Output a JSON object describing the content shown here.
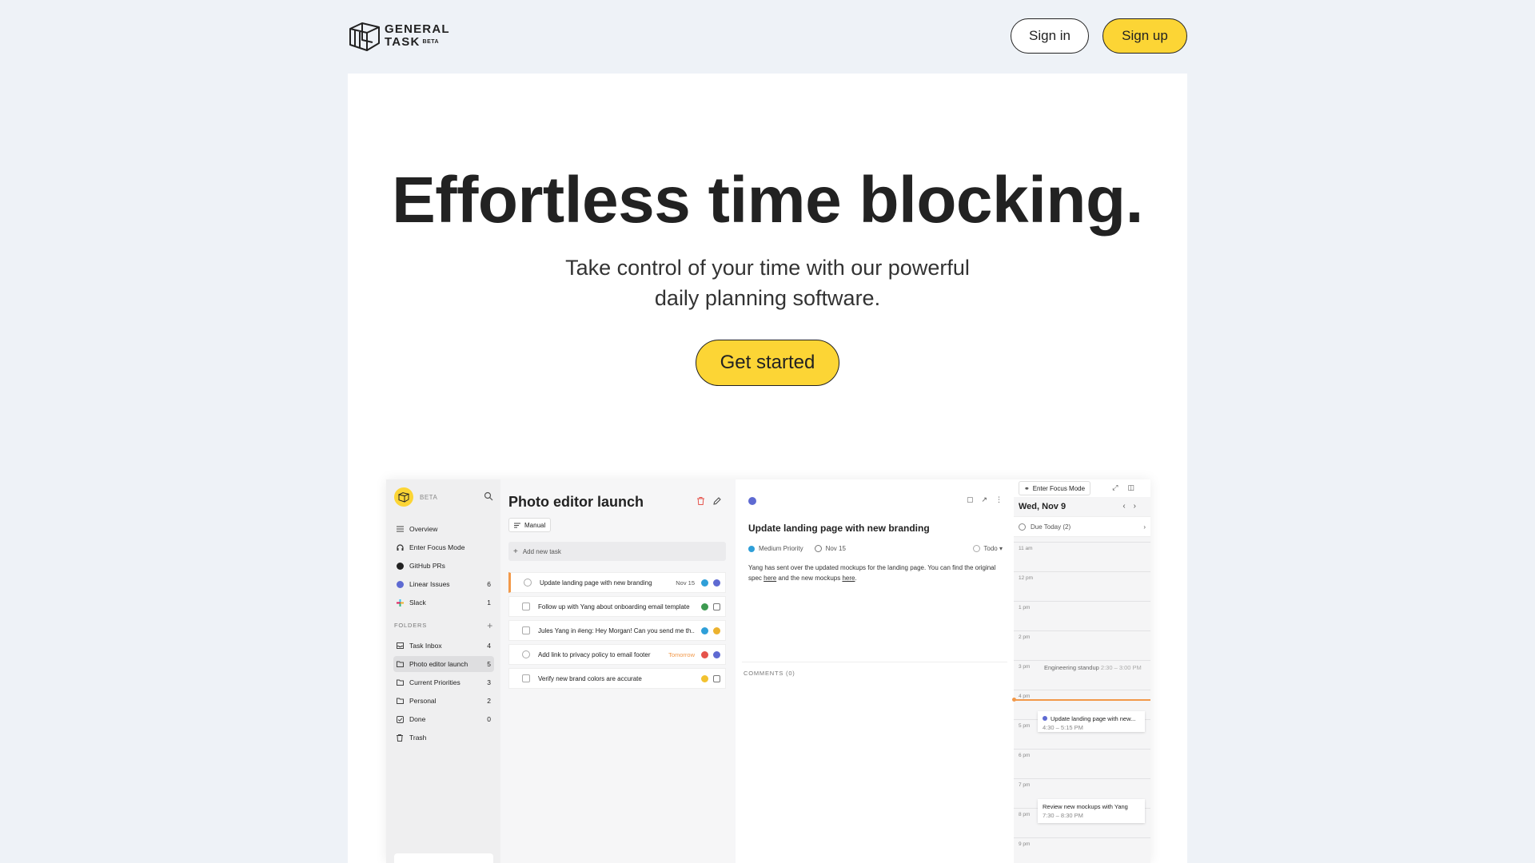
{
  "header": {
    "logo_line1": "GENERAL",
    "logo_line2": "TASK",
    "logo_beta": "BETA",
    "signin_label": "Sign in",
    "signup_label": "Sign up"
  },
  "hero": {
    "title": "Effortless time blocking.",
    "subtitle": "Take control of your time with our powerful daily planning software.",
    "cta_label": "Get started"
  },
  "colors": {
    "accent_yellow": "#fcd535",
    "page_bg": "#eef2f7",
    "accent_orange": "#f2994a",
    "linear_purple": "#5e6ad2"
  },
  "app": {
    "sidebar": {
      "beta_label": "BETA",
      "items": [
        {
          "label": "Overview",
          "count": "",
          "icon": "list-icon"
        },
        {
          "label": "Enter Focus Mode",
          "count": "",
          "icon": "headphones-icon"
        },
        {
          "label": "GitHub PRs",
          "count": "",
          "icon": "github-icon"
        },
        {
          "label": "Linear Issues",
          "count": "6",
          "icon": "linear-icon"
        },
        {
          "label": "Slack",
          "count": "1",
          "icon": "slack-icon"
        }
      ],
      "folders_label": "FOLDERS",
      "folders": [
        {
          "label": "Task Inbox",
          "count": "4",
          "icon": "inbox-icon"
        },
        {
          "label": "Photo editor launch",
          "count": "5",
          "icon": "folder-icon"
        },
        {
          "label": "Current Priorities",
          "count": "3",
          "icon": "folder-icon"
        },
        {
          "label": "Personal",
          "count": "2",
          "icon": "folder-icon"
        },
        {
          "label": "Done",
          "count": "0",
          "icon": "check-icon"
        },
        {
          "label": "Trash",
          "count": "",
          "icon": "trash-icon"
        }
      ]
    },
    "list": {
      "title": "Photo editor launch",
      "sort_label": "Manual",
      "add_placeholder": "Add new task",
      "tasks": [
        {
          "title": "Update landing page with new branding",
          "due": "Nov 15"
        },
        {
          "title": "Follow up with Yang about onboarding email template",
          "due": ""
        },
        {
          "title": "Jules Yang in #eng: Hey Morgan! Can you send me th...",
          "due": ""
        },
        {
          "title": "Add link to privacy policy to email footer",
          "due": "Tomorrow"
        },
        {
          "title": "Verify new brand colors are accurate",
          "due": ""
        }
      ]
    },
    "detail": {
      "title": "Update landing page with new branding",
      "priority": "Medium Priority",
      "due": "Nov 15",
      "status": "Todo",
      "desc_part1": "Yang has sent over the updated mockups for the landing page. You can find the original spec",
      "link1": "here",
      "desc_part2": "and the new mockups",
      "link2": "here",
      "desc_end": ".",
      "comments_label": "COMMENTS (0)"
    },
    "calendar": {
      "focus_label": "Enter Focus Mode",
      "date": "Wed, Nov 9",
      "due_today": "Due Today (2)",
      "hours": [
        "11 am",
        "12 pm",
        "1 pm",
        "2 pm",
        "3 pm",
        "4 pm",
        "5 pm",
        "6 pm",
        "7 pm",
        "8 pm",
        "9 pm"
      ],
      "events": {
        "standup_title": "Engineering standup",
        "standup_time": "2:30 – 3:00 PM",
        "landing_title": "Update landing page with new...",
        "landing_time": "4:30 – 5:15 PM",
        "review_title": "Review new mockups with Yang",
        "review_time": "7:30 – 8:30 PM"
      }
    }
  }
}
